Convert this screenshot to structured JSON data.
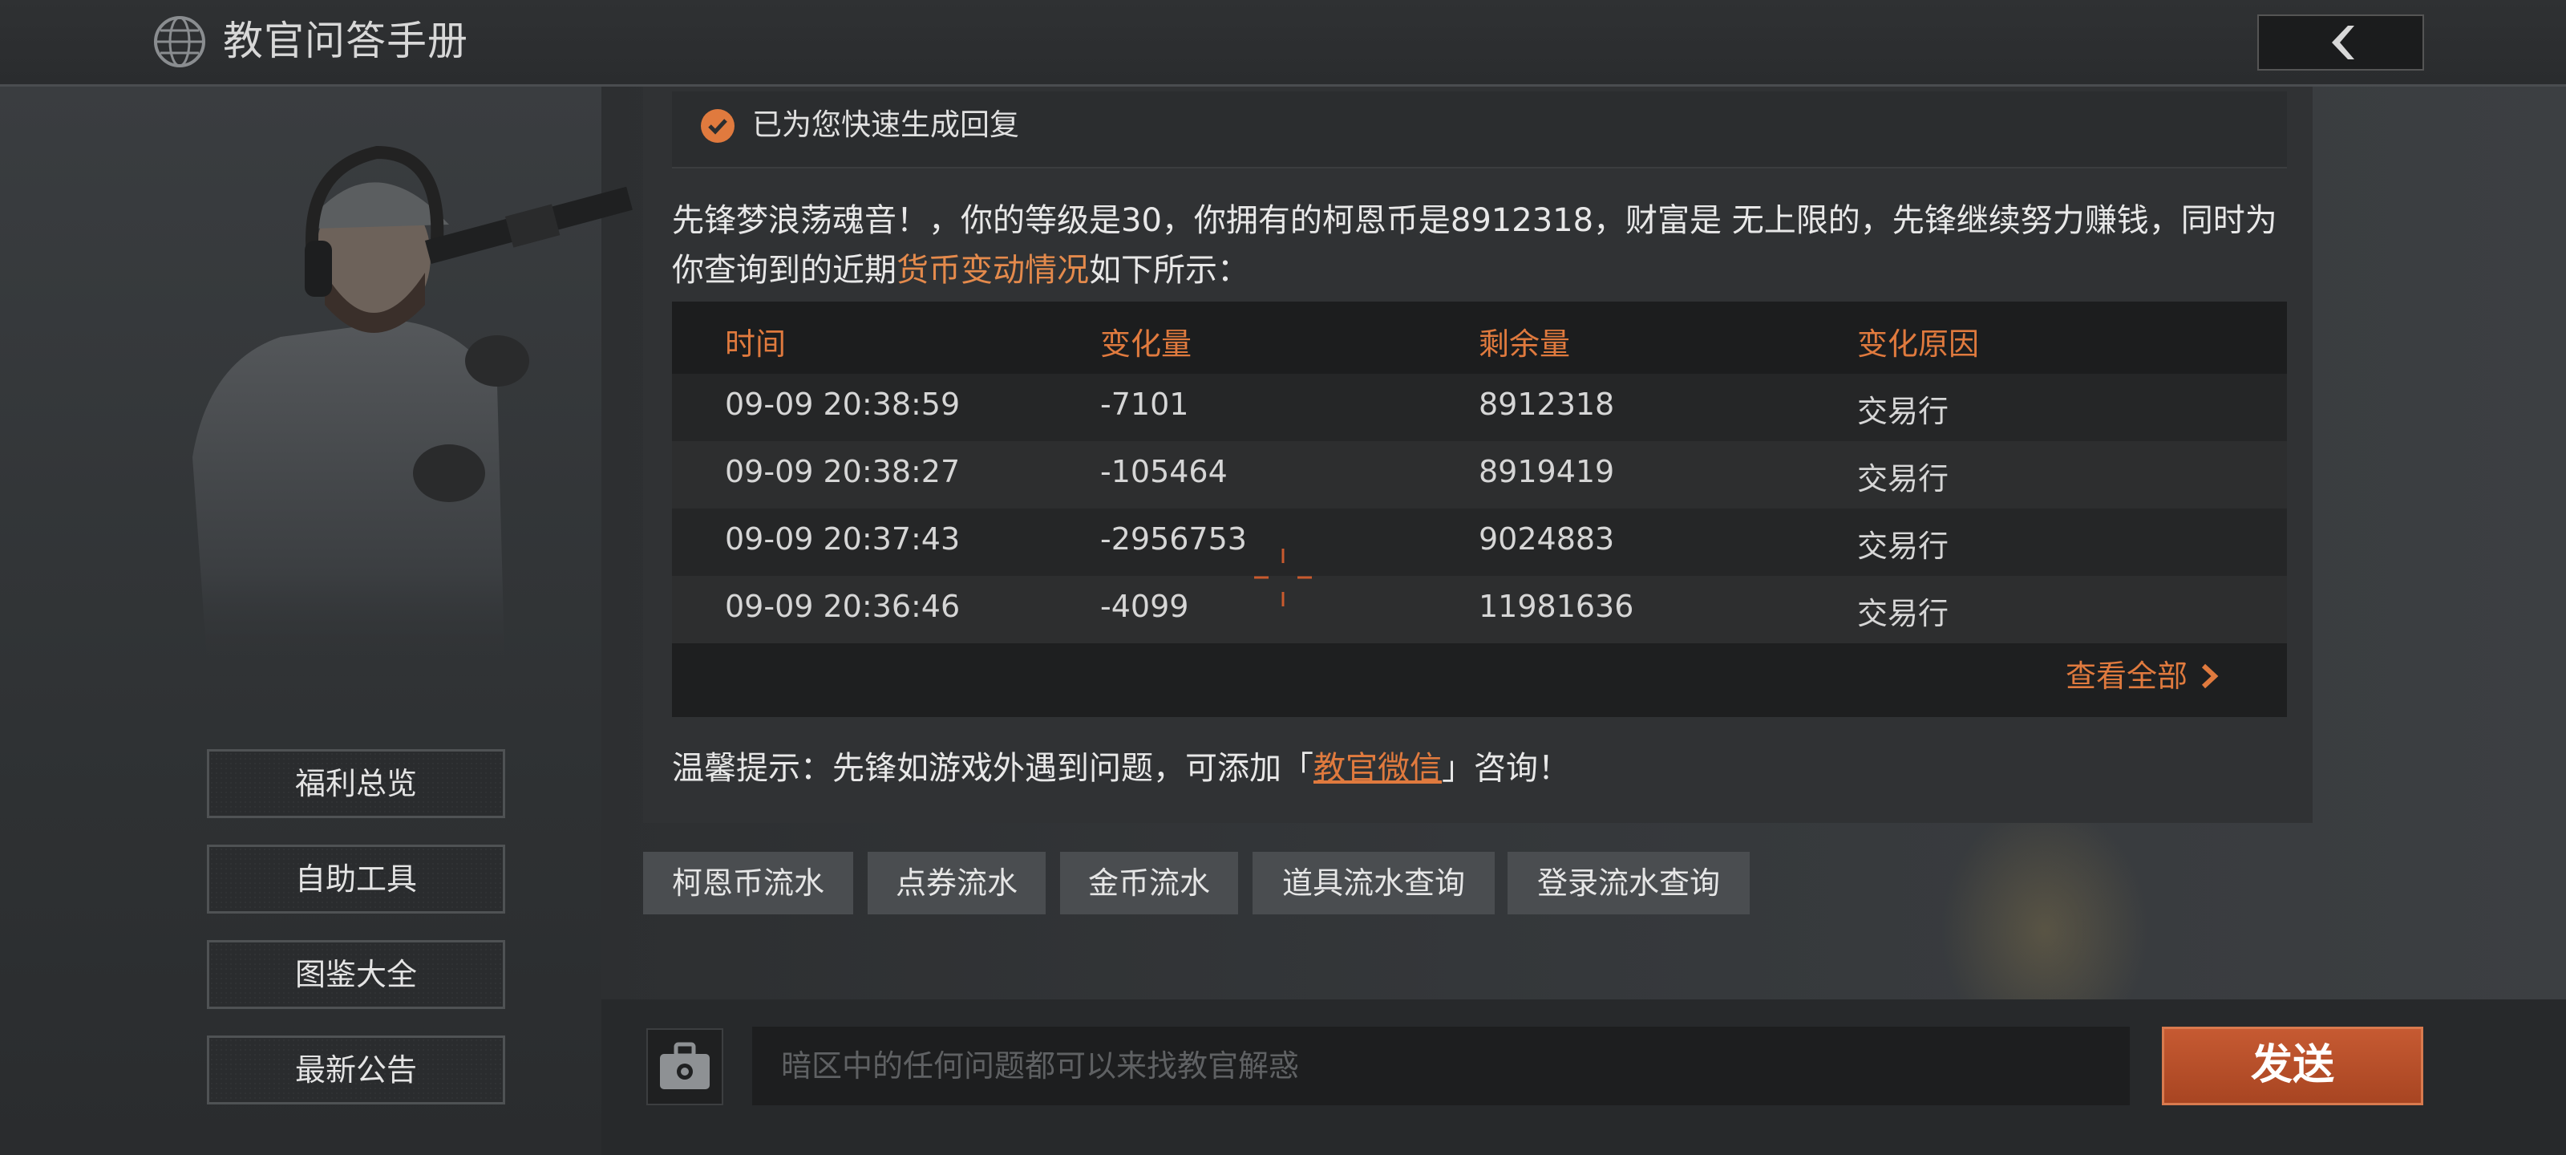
{
  "header": {
    "title": "教官问答手册",
    "globe_icon": "globe-icon",
    "back_icon": "chevron-left-icon"
  },
  "sidebar": {
    "items": [
      {
        "label": "福利总览"
      },
      {
        "label": "自助工具"
      },
      {
        "label": "图鉴大全"
      },
      {
        "label": "最新公告"
      }
    ]
  },
  "chat": {
    "quick_reply": "已为您快速生成回复",
    "message_part1": "先锋梦浪荡魂音！，你的等级是30，你拥有的柯恩币是8912318，财富是 无上限的，先锋继续努力赚钱，同时为你查询到的近期",
    "message_link": "货币变动情况",
    "message_part2": "如下所示：",
    "table": {
      "headers": [
        "时间",
        "变化量",
        "剩余量",
        "变化原因"
      ],
      "rows": [
        [
          "09-09 20:38:59",
          "-7101",
          "8912318",
          "交易行"
        ],
        [
          "09-09 20:38:27",
          "-105464",
          "8919419",
          "交易行"
        ],
        [
          "09-09 20:37:43",
          "-2956753",
          "9024883",
          "交易行"
        ],
        [
          "09-09 20:36:46",
          "-4099",
          "11981636",
          "交易行"
        ]
      ],
      "view_all": "查看全部"
    },
    "tip_prefix": "温馨提示：先锋如游戏外遇到问题，可添加「",
    "tip_link": "教官微信",
    "tip_suffix": "」咨询！"
  },
  "quick_queries": [
    {
      "label": "柯恩币流水"
    },
    {
      "label": "点券流水"
    },
    {
      "label": "金币流水"
    },
    {
      "label": "道具流水查询"
    },
    {
      "label": "登录流水查询"
    }
  ],
  "input": {
    "placeholder": "暗区中的任何问题都可以来找教官解惑",
    "send_label": "发送"
  },
  "colors": {
    "accent": "#e07a3e",
    "send_button": "#b34d29"
  }
}
